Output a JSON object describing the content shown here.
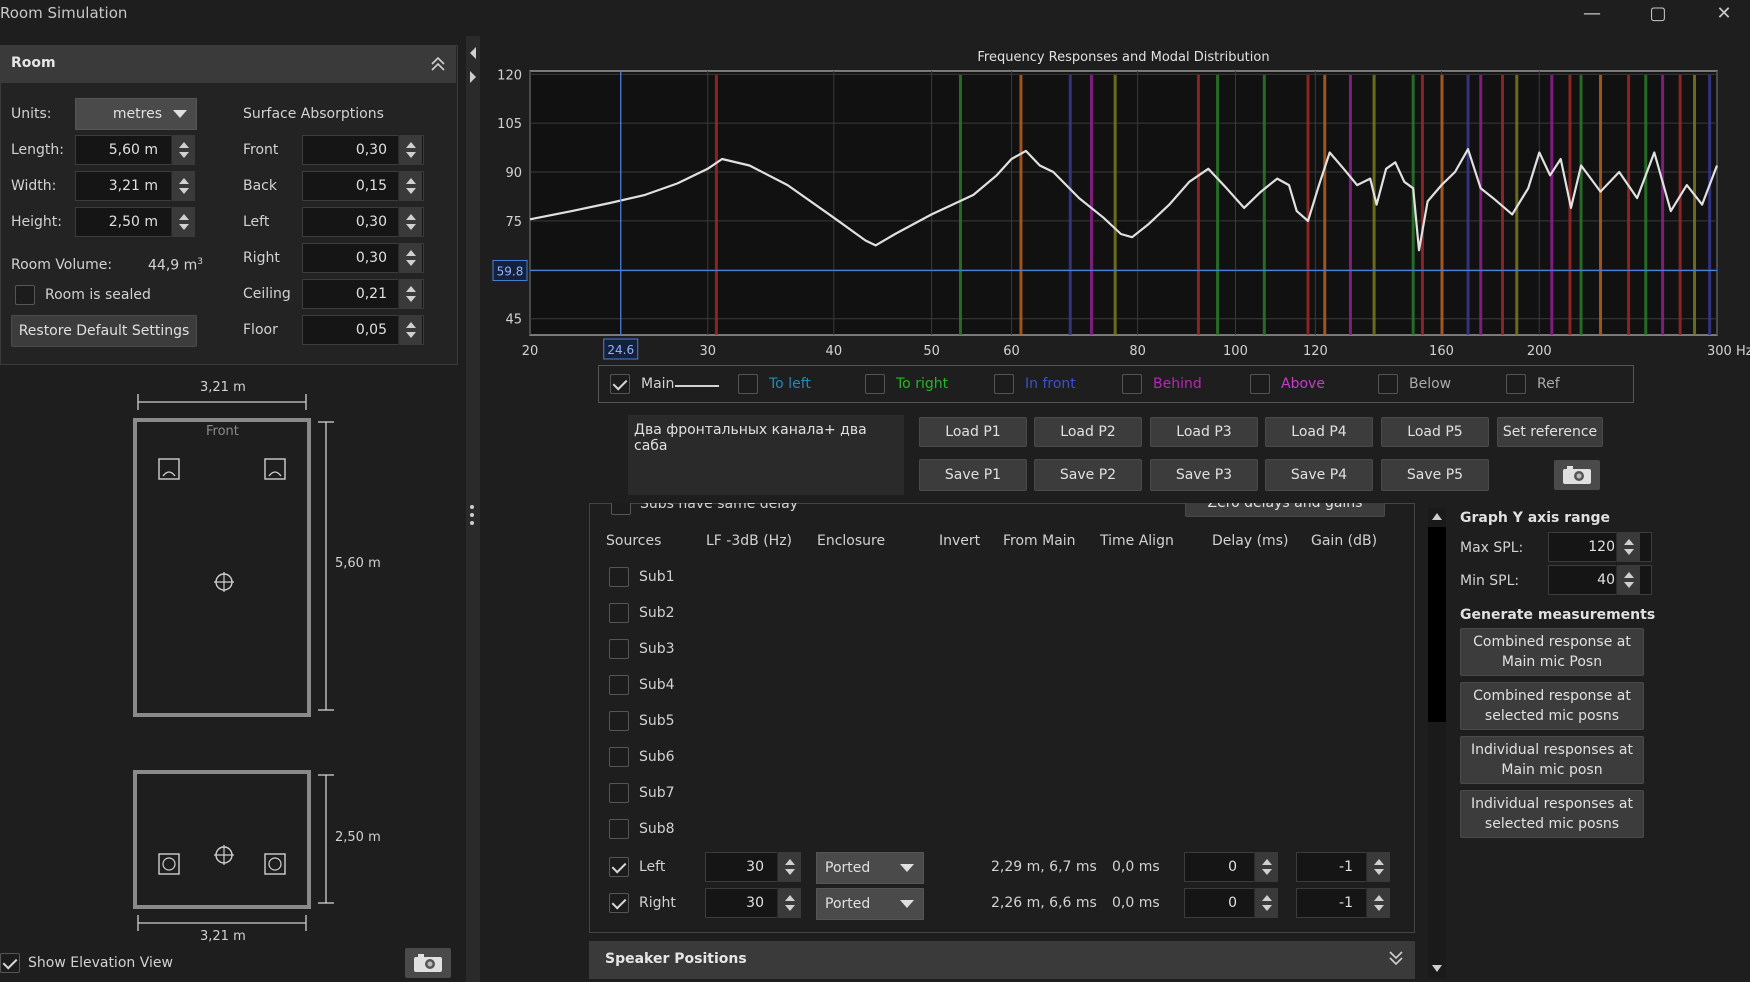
{
  "window": {
    "title": "Room Simulation",
    "minimize": "—",
    "maximize": "▢",
    "close": "✕"
  },
  "room": {
    "header": "Room",
    "units_label": "Units:",
    "units_value": "metres",
    "surface_absorptions": "Surface Absorptions",
    "length_label": "Length:",
    "length_value": "5,60 m",
    "width_label": "Width:",
    "width_value": "3,21 m",
    "height_label": "Height:",
    "height_value": "2,50 m",
    "volume_label": "Room Volume:",
    "volume_value": "44,9 m",
    "volume_unit_sup": "3",
    "sealed_label": "Room is sealed",
    "restore_button": "Restore Default Settings",
    "absorptions": [
      {
        "label": "Front",
        "value": "0,30"
      },
      {
        "label": "Back",
        "value": "0,15"
      },
      {
        "label": "Left",
        "value": "0,30"
      },
      {
        "label": "Right",
        "value": "0,30"
      },
      {
        "label": "Ceiling",
        "value": "0,21"
      },
      {
        "label": "Floor",
        "value": "0,05"
      }
    ]
  },
  "plan": {
    "top_width": "3,21 m",
    "front_label": "Front",
    "length": "5,60 m",
    "elev_height": "2,50 m",
    "elev_width": "3,21 m",
    "show_elevation_label": "Show Elevation View"
  },
  "chart_data": {
    "type": "line",
    "title": "Frequency Responses and Modal Distribution",
    "x_scale": "log",
    "xlim": [
      20,
      300
    ],
    "ylim": [
      40,
      121
    ],
    "x_ticks": [
      20,
      30,
      40,
      50,
      60,
      80,
      100,
      120,
      160,
      200,
      300
    ],
    "x_tick_labels": [
      "20",
      "30",
      "40",
      "50",
      "60",
      "80",
      "100",
      "120",
      "160",
      "200",
      "300 Hz"
    ],
    "y_ticks": [
      45,
      60,
      75,
      90,
      105,
      120
    ],
    "y_tick_labels": [
      "45",
      "",
      "75",
      "90",
      "105",
      "120"
    ],
    "cursor": {
      "x": 24.6,
      "y": 59.8,
      "x_label": "24.6",
      "y_label": "59.8"
    },
    "grid": true,
    "series": [
      {
        "name": "Main",
        "color": "#e0e0e0",
        "x": [
          20,
          22,
          24,
          26,
          28,
          30,
          31,
          33,
          36,
          40,
          43,
          44,
          46,
          50,
          55,
          58,
          60,
          62,
          64,
          66,
          70,
          74,
          77,
          79,
          82,
          86,
          90,
          94,
          98,
          102,
          106,
          110,
          113,
          115,
          118,
          121,
          124,
          128,
          132,
          136,
          138,
          141,
          144,
          147,
          150,
          152,
          155,
          160,
          165,
          170,
          175,
          180,
          188,
          195,
          200,
          205,
          210,
          215,
          220,
          230,
          240,
          250,
          260,
          270,
          280,
          290,
          300
        ],
        "y": [
          75.5,
          78,
          80.5,
          83,
          86.5,
          91,
          94,
          92,
          86,
          76,
          69,
          67.5,
          71,
          77,
          83,
          89,
          94,
          96.5,
          92,
          90,
          82,
          76,
          71,
          70,
          74,
          80,
          87,
          91,
          85,
          79,
          84,
          88,
          86,
          78,
          75,
          86,
          96,
          91,
          86,
          88,
          80,
          91,
          93,
          87,
          85,
          66,
          81,
          86,
          90,
          97,
          85,
          82,
          77,
          85,
          96,
          89,
          94,
          79,
          92,
          84,
          90,
          82,
          96,
          78,
          86,
          80,
          92
        ]
      }
    ],
    "modal_lines": [
      {
        "x": 30.6,
        "color": "#a02828"
      },
      {
        "x": 61.3,
        "color": "#b86020"
      },
      {
        "x": 53.4,
        "color": "#2a7a2a"
      },
      {
        "x": 68.6,
        "color": "#3a3a90"
      },
      {
        "x": 72,
        "color": "#902090"
      },
      {
        "x": 76,
        "color": "#7a7a20"
      },
      {
        "x": 91.9,
        "color": "#a02828"
      },
      {
        "x": 96,
        "color": "#2a7a2a"
      },
      {
        "x": 106.8,
        "color": "#2a7a2a"
      },
      {
        "x": 118,
        "color": "#a02828"
      },
      {
        "x": 122.6,
        "color": "#b86020"
      },
      {
        "x": 130,
        "color": "#902090"
      },
      {
        "x": 137.2,
        "color": "#7a7a20"
      },
      {
        "x": 150,
        "color": "#2a7a2a"
      },
      {
        "x": 153.2,
        "color": "#a02828"
      },
      {
        "x": 160.2,
        "color": "#b86020"
      },
      {
        "x": 170,
        "color": "#3a3a90"
      },
      {
        "x": 175,
        "color": "#902090"
      },
      {
        "x": 183.9,
        "color": "#a02828"
      },
      {
        "x": 190,
        "color": "#7a7a20"
      },
      {
        "x": 205.8,
        "color": "#902090"
      },
      {
        "x": 214.5,
        "color": "#a02828"
      },
      {
        "x": 220,
        "color": "#2a7a2a"
      },
      {
        "x": 230,
        "color": "#b86020"
      },
      {
        "x": 245.2,
        "color": "#a02828"
      },
      {
        "x": 255,
        "color": "#2a7a2a"
      },
      {
        "x": 265,
        "color": "#902090"
      },
      {
        "x": 275.8,
        "color": "#a02828"
      },
      {
        "x": 285,
        "color": "#7a7a20"
      },
      {
        "x": 295,
        "color": "#3a3a90"
      }
    ]
  },
  "legend": [
    {
      "label": "Main",
      "checked": true,
      "color": "#d2d2d2"
    },
    {
      "label": "To left",
      "checked": false,
      "color": "#1e8cb4"
    },
    {
      "label": "To right",
      "checked": false,
      "color": "#28b428"
    },
    {
      "label": "In front",
      "checked": false,
      "color": "#3c50d2"
    },
    {
      "label": "Behind",
      "checked": false,
      "color": "#b428b4"
    },
    {
      "label": "Above",
      "checked": false,
      "color": "#c83cc8"
    },
    {
      "label": "Below",
      "checked": false,
      "color": "#aaaaaa"
    },
    {
      "label": "Ref",
      "checked": false,
      "color": "#aaaaaa"
    }
  ],
  "notes_text": "Два фронтальных канала+ два саба",
  "presets": {
    "load": [
      "Load P1",
      "Load P2",
      "Load P3",
      "Load P4",
      "Load P5"
    ],
    "save": [
      "Save P1",
      "Save P2",
      "Save P3",
      "Save P4",
      "Save P5"
    ],
    "set_reference": "Set reference"
  },
  "sources": {
    "partial_top_label": "Subs have same delay",
    "partial_top_button": "Zero delays and gains",
    "headers": [
      "Sources",
      "LF -3dB (Hz)",
      "Enclosure",
      "Invert",
      "From Main",
      "Time Align",
      "Delay (ms)",
      "Gain (dB)"
    ],
    "subs": [
      "Sub1",
      "Sub2",
      "Sub3",
      "Sub4",
      "Sub5",
      "Sub6",
      "Sub7",
      "Sub8"
    ],
    "mains": [
      {
        "name": "Left",
        "checked": true,
        "lf": "30",
        "enclosure": "Ported",
        "from_main": "2,29 m, 6,7 ms",
        "time_align": "0,0 ms",
        "delay": "0",
        "gain": "-1"
      },
      {
        "name": "Right",
        "checked": true,
        "lf": "30",
        "enclosure": "Ported",
        "from_main": "2,26 m, 6,6 ms",
        "time_align": "0,0 ms",
        "delay": "0",
        "gain": "-1"
      }
    ]
  },
  "speaker_positions": "Speaker Positions",
  "graph_range": {
    "title": "Graph Y axis range",
    "max_label": "Max SPL:",
    "max_value": "120",
    "min_label": "Min SPL:",
    "min_value": "40"
  },
  "generate": {
    "title": "Generate measurements",
    "buttons": [
      [
        "Combined response at",
        "Main mic Posn"
      ],
      [
        "Combined response at",
        "selected mic posns"
      ],
      [
        "Individual responses at",
        "Main mic posn"
      ],
      [
        "Individual responses at",
        "selected mic posns"
      ]
    ]
  }
}
